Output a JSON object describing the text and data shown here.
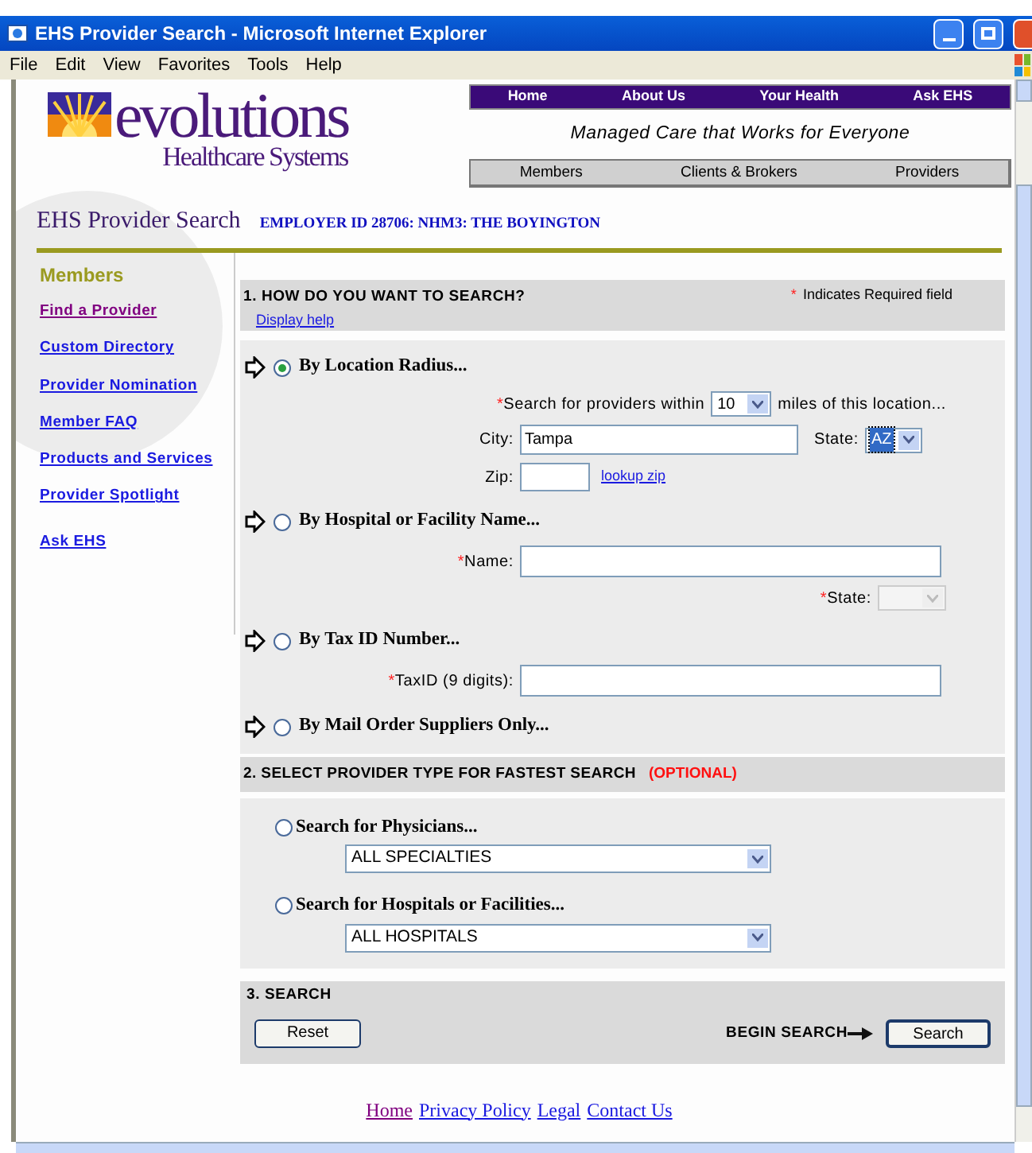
{
  "window": {
    "title": "EHS Provider Search - Microsoft Internet Explorer"
  },
  "menu_bar": [
    "File",
    "Edit",
    "View",
    "Favorites",
    "Tools",
    "Help"
  ],
  "logo": {
    "name": "evolutions",
    "subtitle": "Healthcare Systems"
  },
  "top_nav": [
    "Home",
    "About Us",
    "Your Health",
    "Ask EHS"
  ],
  "tagline": "Managed Care that Works for Everyone",
  "section_nav": [
    "Members",
    "Clients & Brokers",
    "Providers"
  ],
  "page_title": "EHS Provider Search",
  "employer": "EMPLOYER ID 28706: NHM3: THE BOYINGTON",
  "sidebar": {
    "heading": "Members",
    "items": [
      {
        "label": "Find a Provider",
        "visited": true
      },
      {
        "label": "Custom Directory",
        "visited": false
      },
      {
        "label": "Provider Nomination",
        "visited": false
      },
      {
        "label": "Member FAQ",
        "visited": false
      },
      {
        "label": "Products and Services",
        "visited": false
      },
      {
        "label": "Provider Spotlight",
        "visited": false
      },
      {
        "label": "Ask EHS",
        "visited": false
      }
    ]
  },
  "section_1": {
    "heading": "1. HOW DO YOU WANT TO SEARCH?",
    "required_mark": "*",
    "required_note": "Indicates Required field",
    "help_link": "Display help",
    "options": [
      {
        "label": "By Location Radius...",
        "selected": true,
        "rows": [
          {
            "kind": "trailing",
            "items": [
              {
                "kind": "label",
                "text": "Search for providers within",
                "required": true
              },
              {
                "kind": "select",
                "value": "10",
                "highlighted": false,
                "disabled": false
              },
              {
                "kind": "label",
                "text": "miles of this location...",
                "required": false
              }
            ]
          },
          {
            "kind": "labeled",
            "items": [
              {
                "kind": "label",
                "text": "City:",
                "required": false
              },
              {
                "kind": "input",
                "value": "Tampa"
              },
              {
                "kind": "label",
                "text": "State:",
                "required": false
              },
              {
                "kind": "select",
                "value": "AZ",
                "highlighted": true,
                "disabled": false
              }
            ]
          },
          {
            "kind": "labeled",
            "items": [
              {
                "kind": "label",
                "text": "Zip:",
                "required": false
              },
              {
                "kind": "short_input"
              },
              {
                "kind": "link",
                "text": "lookup zip"
              }
            ]
          }
        ]
      },
      {
        "label": "By Hospital or Facility Name...",
        "selected": false,
        "rows": [
          {
            "kind": "labeled",
            "items": [
              {
                "kind": "label",
                "text": "Name:",
                "required": true
              },
              {
                "kind": "wide_input"
              }
            ]
          },
          {
            "kind": "trailing",
            "items": [
              {
                "kind": "label",
                "text": "State:",
                "required": true
              },
              {
                "kind": "select",
                "disabled": true
              }
            ]
          }
        ]
      },
      {
        "label": "By Tax ID Number...",
        "selected": false,
        "rows": [
          {
            "kind": "labeled",
            "items": [
              {
                "kind": "label",
                "text": "TaxID (9 digits):",
                "required": true
              },
              {
                "kind": "wide_input"
              }
            ]
          }
        ]
      },
      {
        "label": "By Mail Order Suppliers Only...",
        "selected": false
      }
    ]
  },
  "section_2": {
    "heading": "2. SELECT PROVIDER TYPE FOR FASTEST SEARCH",
    "optional": "(OPTIONAL)",
    "types": [
      {
        "label": "Search for Physicians...",
        "selected": false,
        "value": "ALL SPECIALTIES"
      },
      {
        "label": "Search for Hospitals or Facilities...",
        "selected": false,
        "value": "ALL HOSPITALS"
      }
    ]
  },
  "section_3": {
    "heading": "3. SEARCH",
    "reset": "Reset",
    "begin_label": "BEGIN SEARCH",
    "search": "Search"
  },
  "footer_links": [
    {
      "label": "Home",
      "visited": true
    },
    {
      "label": "Privacy Policy",
      "visited": false
    },
    {
      "label": "Legal",
      "visited": false
    },
    {
      "label": "Contact Us",
      "visited": false
    }
  ]
}
